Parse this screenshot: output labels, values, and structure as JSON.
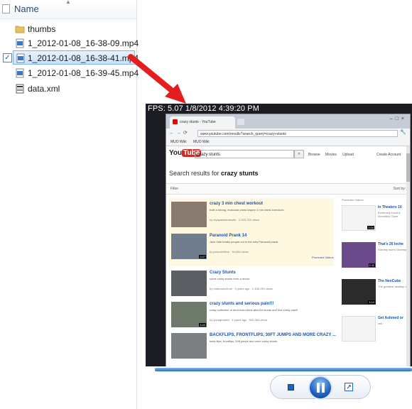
{
  "explorer": {
    "column_header": "Name",
    "files": [
      {
        "name": "thumbs",
        "type": "folder",
        "selected": false,
        "checked": false
      },
      {
        "name": "1_2012-01-08_16-38-09.mp4",
        "type": "video",
        "selected": false,
        "checked": false
      },
      {
        "name": "1_2012-01-08_16-38-41.mp4",
        "type": "video",
        "selected": true,
        "checked": true
      },
      {
        "name": "1_2012-01-08_16-39-45.mp4",
        "type": "video",
        "selected": false,
        "checked": false
      },
      {
        "name": "data.xml",
        "type": "xml",
        "selected": false,
        "checked": false
      }
    ],
    "check_mark": "✓"
  },
  "annotation": {
    "arrow_color": "#e41e1e"
  },
  "player": {
    "overlay_text": "FPS: 5.07 1/8/2012 4:39:20 PM",
    "browser": {
      "tab_title": "crazy stunts - YouTube",
      "url": "www.youtube.com/results?search_query=crazy+stunts",
      "bookmarks": [
        "MUO Wiki",
        "MUO Wiki"
      ],
      "logo_you": "You",
      "logo_tube": "Tube",
      "search_value": "crazy stunts",
      "nav": [
        "Browse",
        "Movies",
        "Upload",
        "Create Account"
      ],
      "results_prefix": "Search results for ",
      "results_query": "crazy stunts",
      "filter_label": "Filter",
      "sort_label": "Sort by:",
      "promoted_label": "Promoted Videos",
      "sidebar_header": "Promoted Videos",
      "results": [
        {
          "title": "crazy 3 min chest workout",
          "desc": "built a strong, muscular chest inspire 3 min chest exercises",
          "meta": "by elyapaksfamtsofts · 2,333,745 views",
          "duration": ""
        },
        {
          "title": "Paranoid Prank 14",
          "desc": "Jack Vale freaks people out in the new Paranoid prank",
          "meta": "by jackvalefilms · 94,684 views",
          "duration": "2:07"
        },
        {
          "title": "Crazy Stunts",
          "desc": "some crazy stunts from a movie",
          "meta": "by tradeoues2mdl · 3 years ago · 1,336,193 views",
          "duration": ""
        },
        {
          "title": "crazy stunts and serious pain!!!",
          "desc": "crazy collection of dont-even-think-about-it stunts and foot every pain!!",
          "meta": "by youngfowleri · 4 years ago · 932,363 views",
          "duration": "3:40"
        },
        {
          "title": "BACKFLIPS, FRONTFLIPS, 30FT JUMPS AND MORE CRAZY ...",
          "desc": "back flips, frontflips, 30ft jumps and more crazy stunts",
          "meta": "",
          "duration": ""
        }
      ],
      "sidebar_items": [
        {
          "title": "In Theaters 10",
          "desc": "Extremely Loud & Incredibly Close",
          "duration": "2:04"
        },
        {
          "title": "That's 26 Inche",
          "desc": "Gummy worm Gummy",
          "duration": "2:11"
        },
        {
          "title": "The NeoCube",
          "desc": "The greatest desktop toy!",
          "duration": "3:14"
        },
        {
          "title": "Get Ashmed or",
          "desc": "cell",
          "duration": ""
        }
      ]
    },
    "seek_progress": 0.9,
    "accent": "#1f62c2"
  }
}
